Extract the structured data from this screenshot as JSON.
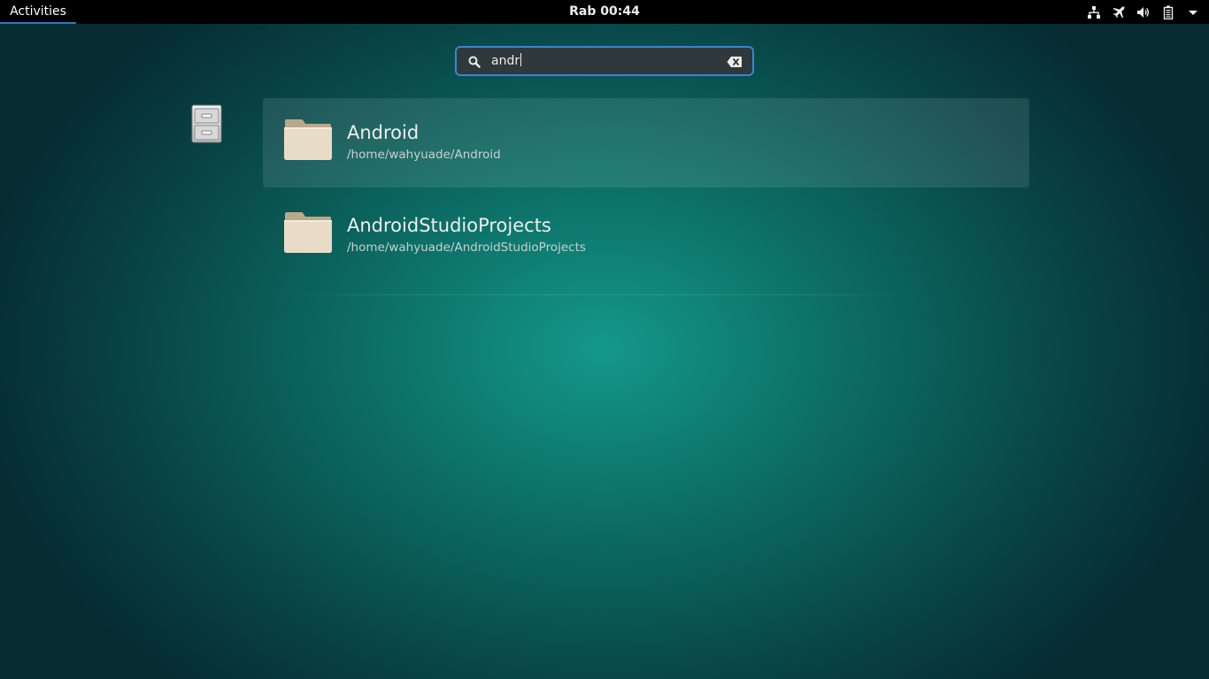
{
  "topbar": {
    "activities_label": "Activities",
    "clock": "Rab 00:44",
    "tray_icons": [
      "network-wired-icon",
      "airplane-mode-icon",
      "volume-icon",
      "battery-icon",
      "system-menu-arrow-icon"
    ]
  },
  "search": {
    "value": "andr",
    "icon": "search-icon",
    "clear_icon": "clear-text-icon"
  },
  "provider": {
    "icon": "file-cabinet-icon"
  },
  "results": [
    {
      "name": "Android",
      "path": "/home/wahyuade/Android",
      "icon": "folder-icon",
      "selected": true
    },
    {
      "name": "AndroidStudioProjects",
      "path": "/home/wahyuade/AndroidStudioProjects",
      "icon": "folder-icon",
      "selected": false
    }
  ],
  "colors": {
    "accent": "#3d83d4",
    "topbar": "#000000",
    "background_center": "#14988a",
    "background_edge": "#062b31"
  }
}
